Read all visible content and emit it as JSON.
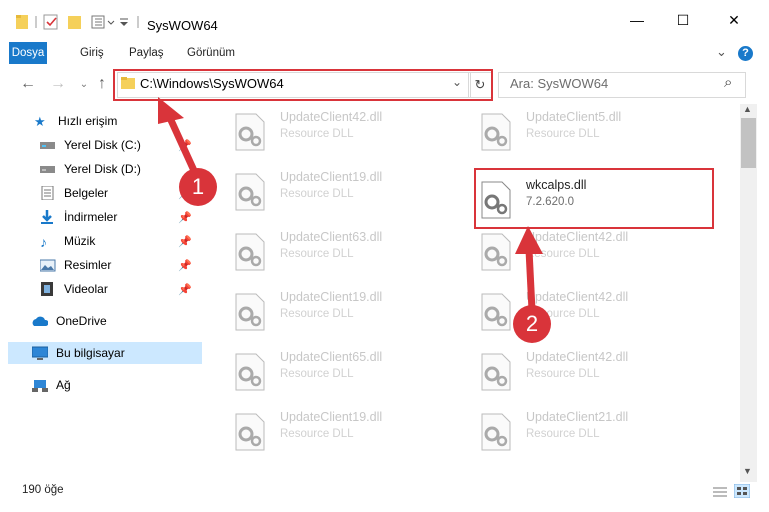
{
  "window": {
    "title": "SysWOW64",
    "minimize_label": "—",
    "maximize_label": "☐",
    "close_label": "✕"
  },
  "ribbon": {
    "tabs": [
      "Dosya",
      "Giriş",
      "Paylaş",
      "Görünüm"
    ],
    "help_glyph": "?",
    "expand_glyph": "⌄"
  },
  "navigation": {
    "back": "←",
    "forward": "→",
    "up": "↑",
    "address": "C:\\Windows\\SysWOW64",
    "refresh": "↻",
    "search_placeholder": "Ara: SysWOW64",
    "search_glyph": "⌕"
  },
  "sidebar": {
    "items": [
      {
        "label": "Hızlı erişim",
        "icon": "star-icon"
      },
      {
        "label": "Yerel Disk (C:)",
        "icon": "drive-icon",
        "pinned": true
      },
      {
        "label": "Yerel Disk (D:)",
        "icon": "drive-icon",
        "pinned": false
      },
      {
        "label": "Belgeler",
        "icon": "documents-icon",
        "pinned": true
      },
      {
        "label": "İndirmeler",
        "icon": "download-icon",
        "pinned": true
      },
      {
        "label": "Müzik",
        "icon": "music-icon",
        "pinned": true
      },
      {
        "label": "Resimler",
        "icon": "pictures-icon",
        "pinned": true
      },
      {
        "label": "Videolar",
        "icon": "videos-icon",
        "pinned": true
      },
      {
        "label": "OneDrive",
        "icon": "cloud-icon"
      },
      {
        "label": "Bu bilgisayar",
        "icon": "computer-icon",
        "selected": true
      },
      {
        "label": "Ağ",
        "icon": "network-icon"
      }
    ]
  },
  "files": {
    "left_column": [
      {
        "name": "UpdateClient42.dll",
        "desc": "Resource DLL"
      },
      {
        "name": "UpdateClient19.dll",
        "desc": "Resource DLL"
      },
      {
        "name": "UpdateClient63.dll",
        "desc": "Resource DLL"
      },
      {
        "name": "UpdateClient19.dll",
        "desc": "Resource DLL"
      },
      {
        "name": "UpdateClient65.dll",
        "desc": "Resource DLL"
      },
      {
        "name": "UpdateClient19.dll",
        "desc": "Resource DLL"
      }
    ],
    "right_column": [
      {
        "name": "UpdateClient5.dll",
        "desc": "Resource DLL"
      },
      {
        "name": "wkcalps.dll",
        "desc": "7.2.620.0",
        "highlighted": true
      },
      {
        "name": "UpdateClient42.dll",
        "desc": "Resource DLL"
      },
      {
        "name": "UpdateClient42.dll",
        "desc": "Resource DLL"
      },
      {
        "name": "UpdateClient42.dll",
        "desc": "Resource DLL"
      },
      {
        "name": "UpdateClient21.dll",
        "desc": "Resource DLL"
      }
    ]
  },
  "status": {
    "item_count": "190 öğe"
  },
  "annotations": {
    "step1": "1",
    "step2": "2",
    "color": "#d9343a"
  }
}
